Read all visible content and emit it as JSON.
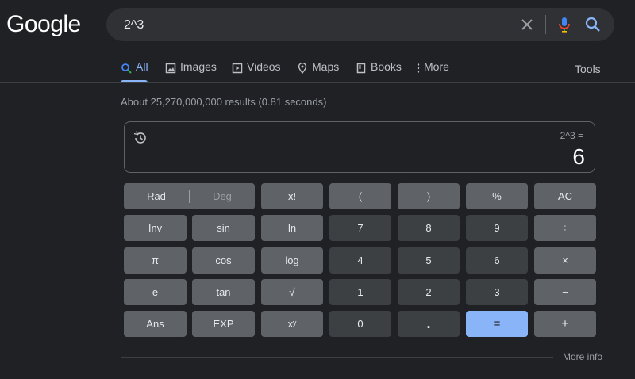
{
  "logo": "Google",
  "search": {
    "value": "2^3"
  },
  "tabs": [
    {
      "label": "All",
      "icon": "search-icon",
      "active": true
    },
    {
      "label": "Images",
      "icon": "image-icon"
    },
    {
      "label": "Videos",
      "icon": "play-icon"
    },
    {
      "label": "Maps",
      "icon": "map-pin-icon"
    },
    {
      "label": "Books",
      "icon": "book-icon"
    },
    {
      "label": "More",
      "icon": "more-vert-icon"
    }
  ],
  "tools_label": "Tools",
  "result_stats": "About 25,270,000,000 results (0.81 seconds)",
  "calculator": {
    "expression": "2^3 =",
    "result": "6",
    "rad_label": "Rad",
    "deg_label": "Deg",
    "keys": {
      "factorial": "x!",
      "open_paren": "(",
      "close_paren": ")",
      "percent": "%",
      "clear": "AC",
      "inv": "Inv",
      "sin": "sin",
      "ln": "ln",
      "seven": "7",
      "eight": "8",
      "nine": "9",
      "divide": "÷",
      "pi": "π",
      "cos": "cos",
      "log": "log",
      "four": "4",
      "five": "5",
      "six": "6",
      "multiply": "×",
      "e": "e",
      "tan": "tan",
      "sqrt": "√",
      "one": "1",
      "two": "2",
      "three": "3",
      "minus": "−",
      "ans": "Ans",
      "exp": "EXP",
      "power": "xʸ",
      "zero": "0",
      "dot": ".",
      "equals": "=",
      "plus": "+"
    },
    "more_info": "More info"
  },
  "colors": {
    "background": "#202124",
    "accent": "#8ab4f8",
    "func_key": "#5f6368",
    "num_key": "#3c4043"
  }
}
